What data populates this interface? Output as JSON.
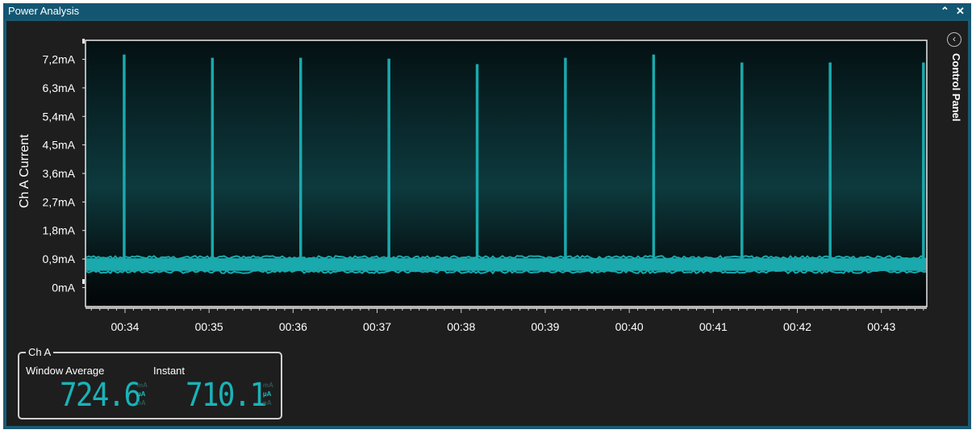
{
  "window": {
    "title": "Power Analysis",
    "maximize_icon": "chevron-up-icon",
    "close_icon": "close-icon"
  },
  "control_panel": {
    "label": "Control Panel",
    "toggle_icon": "chevron-left-circle-icon"
  },
  "colors": {
    "trace": "#1aa9ad",
    "plot_bg_top": "#041012",
    "plot_bg_mid": "#0d3a3e",
    "titlebar": "#135672",
    "panel_bg": "#1e1e1e"
  },
  "chart_data": {
    "type": "line",
    "ylabel": "Ch A Current",
    "xlabel": "",
    "y_ticks": [
      "0mA",
      "0,9mA",
      "1,8mA",
      "2,7mA",
      "3,6mA",
      "4,5mA",
      "5,4mA",
      "6,3mA",
      "7,2mA"
    ],
    "ylim_mA": [
      -0.6,
      7.8
    ],
    "x_ticks": [
      "00:34",
      "00:35",
      "00:36",
      "00:37",
      "00:38",
      "00:39",
      "00:40",
      "00:41",
      "00:42",
      "00:43"
    ],
    "xlim_s": [
      33.53,
      43.54
    ],
    "baseline_mA": 0.72,
    "baseline_band_mA": [
      0.45,
      1.0
    ],
    "series": [
      {
        "values": [
          {
            "t": 33.99,
            "peak_mA": 7.35
          },
          {
            "t": 35.04,
            "peak_mA": 7.25
          },
          {
            "t": 36.09,
            "peak_mA": 7.25
          },
          {
            "t": 37.14,
            "peak_mA": 7.22
          },
          {
            "t": 38.19,
            "peak_mA": 7.05
          },
          {
            "t": 39.24,
            "peak_mA": 7.25
          },
          {
            "t": 40.29,
            "peak_mA": 7.35
          },
          {
            "t": 41.34,
            "peak_mA": 7.1
          },
          {
            "t": 42.39,
            "peak_mA": 7.1
          },
          {
            "t": 43.5,
            "peak_mA": 7.1
          }
        ]
      }
    ],
    "grid": false
  },
  "channel_panel": {
    "title": "Ch A",
    "window_average_label": "Window Average",
    "instant_label": "Instant",
    "window_average_value": "724.6",
    "instant_value": "710.1",
    "units": [
      "mA",
      "µA",
      "nA"
    ],
    "selected_unit": "µA"
  }
}
